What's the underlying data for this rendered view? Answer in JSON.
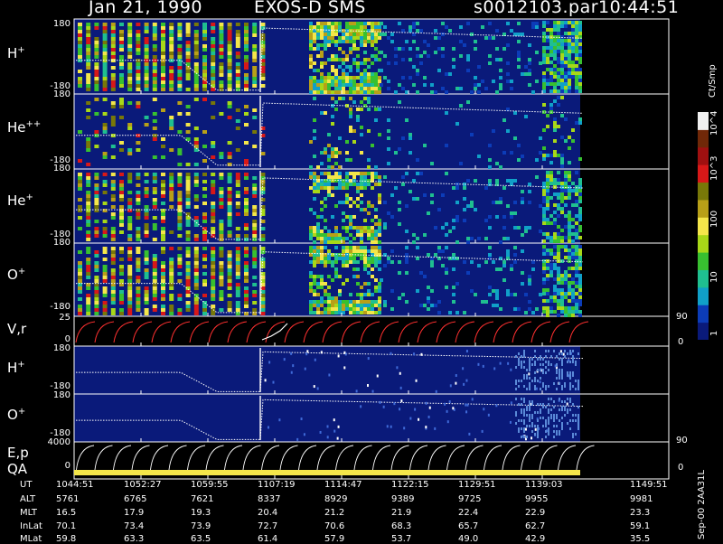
{
  "header": {
    "date": "Jan 21, 1990",
    "instrument": "EXOS-D SMS",
    "file": "s0012103.par",
    "time": "10:44:51"
  },
  "colors": {
    "background": "#000000",
    "text": "#ffffff",
    "field": "#0a1a7a",
    "trace_red": "#ff3030",
    "qa_bar": "#f4e64a"
  },
  "panels": [
    {
      "id": "hplus",
      "label": "H",
      "sup": "+",
      "ytop": "180",
      "ybot": "-180",
      "kind": "spectrogram"
    },
    {
      "id": "hepp",
      "label": "He",
      "sup": "++",
      "ytop": "180",
      "ybot": "-180",
      "kind": "spectrogram"
    },
    {
      "id": "heplus",
      "label": "He",
      "sup": "+",
      "ytop": "180",
      "ybot": "-180",
      "kind": "spectrogram"
    },
    {
      "id": "oplus",
      "label": "O",
      "sup": "+",
      "ytop": "180",
      "ybot": "-180",
      "kind": "spectrogram"
    },
    {
      "id": "vr",
      "label": "V,r",
      "sup": "",
      "ytop": "25",
      "ybot": "0",
      "right_top": "90",
      "right_bot": "0",
      "kind": "line"
    },
    {
      "id": "hplus2",
      "label": "H",
      "sup": "+",
      "ytop": "180",
      "ybot": "-180",
      "kind": "sparse"
    },
    {
      "id": "oplus2",
      "label": "O",
      "sup": "+",
      "ytop": "180",
      "ybot": "-180",
      "kind": "sparse"
    },
    {
      "id": "ep",
      "label": "E,p",
      "sup": "",
      "label2": "QA",
      "ytop": "4000",
      "ybot": "0",
      "right_top": "90",
      "right_bot": "0",
      "kind": "energy"
    }
  ],
  "colorbar": {
    "unit": "Ct/Smp",
    "ticks": [
      "10^4",
      "10^3",
      "100",
      "10",
      "1"
    ],
    "stops": [
      "#0a1a7a",
      "#0c3cb8",
      "#10a0c8",
      "#1fbf90",
      "#38c030",
      "#a8d818",
      "#f4e64a",
      "#b8a018",
      "#787808",
      "#d81818",
      "#a01010",
      "#702808",
      "#f0f0f0"
    ]
  },
  "footer": {
    "row_labels": [
      "UT",
      "ALT",
      "MLT",
      "InLat",
      "MLat"
    ],
    "columns": [
      {
        "UT": "1044:51",
        "ALT": "5761",
        "MLT": "16.5",
        "InLat": "70.1",
        "MLat": "59.8"
      },
      {
        "UT": "1052:27",
        "ALT": "6765",
        "MLT": "17.9",
        "InLat": "73.4",
        "MLat": "63.3"
      },
      {
        "UT": "1059:55",
        "ALT": "7621",
        "MLT": "19.3",
        "InLat": "73.9",
        "MLat": "63.5"
      },
      {
        "UT": "1107:19",
        "ALT": "8337",
        "MLT": "20.4",
        "InLat": "72.7",
        "MLat": "61.4"
      },
      {
        "UT": "1114:47",
        "ALT": "8929",
        "MLT": "21.2",
        "InLat": "70.6",
        "MLat": "57.9"
      },
      {
        "UT": "1122:15",
        "ALT": "9389",
        "MLT": "21.9",
        "InLat": "68.3",
        "MLat": "53.7"
      },
      {
        "UT": "1129:51",
        "ALT": "9725",
        "MLT": "22.4",
        "InLat": "65.7",
        "MLat": "49.0"
      },
      {
        "UT": "1139:03",
        "ALT": "9955",
        "MLT": "22.9",
        "InLat": "62.7",
        "MLat": "42.9"
      },
      {
        "UT": "1149:51",
        "ALT": "9981",
        "MLT": "23.3",
        "InLat": "59.1",
        "MLat": "35.5"
      }
    ]
  },
  "stamp": "Sep-00 2AA31L",
  "chart_data": {
    "type": "heatmap",
    "title": "Jan 21, 1990   EXOS-D SMS",
    "xlabel": "UT",
    "ylabel": "",
    "x_ticks": [
      "1044:51",
      "1052:27",
      "1059:55",
      "1107:19",
      "1114:47",
      "1122:15",
      "1129:51",
      "1139:03",
      "1149:51"
    ],
    "y_range_spectrograms": [
      -180,
      180
    ],
    "y_range_vr": [
      0,
      25
    ],
    "y_range_ep": [
      0,
      4000
    ],
    "colorbar": {
      "unit": "Ct/Smp",
      "scale": "log",
      "range": [
        1,
        10000
      ]
    },
    "series": [
      {
        "name": "H+"
      },
      {
        "name": "He++"
      },
      {
        "name": "He+"
      },
      {
        "name": "O+"
      },
      {
        "name": "V,r"
      },
      {
        "name": "H+"
      },
      {
        "name": "O+"
      },
      {
        "name": "E,p"
      },
      {
        "name": "QA"
      }
    ]
  }
}
